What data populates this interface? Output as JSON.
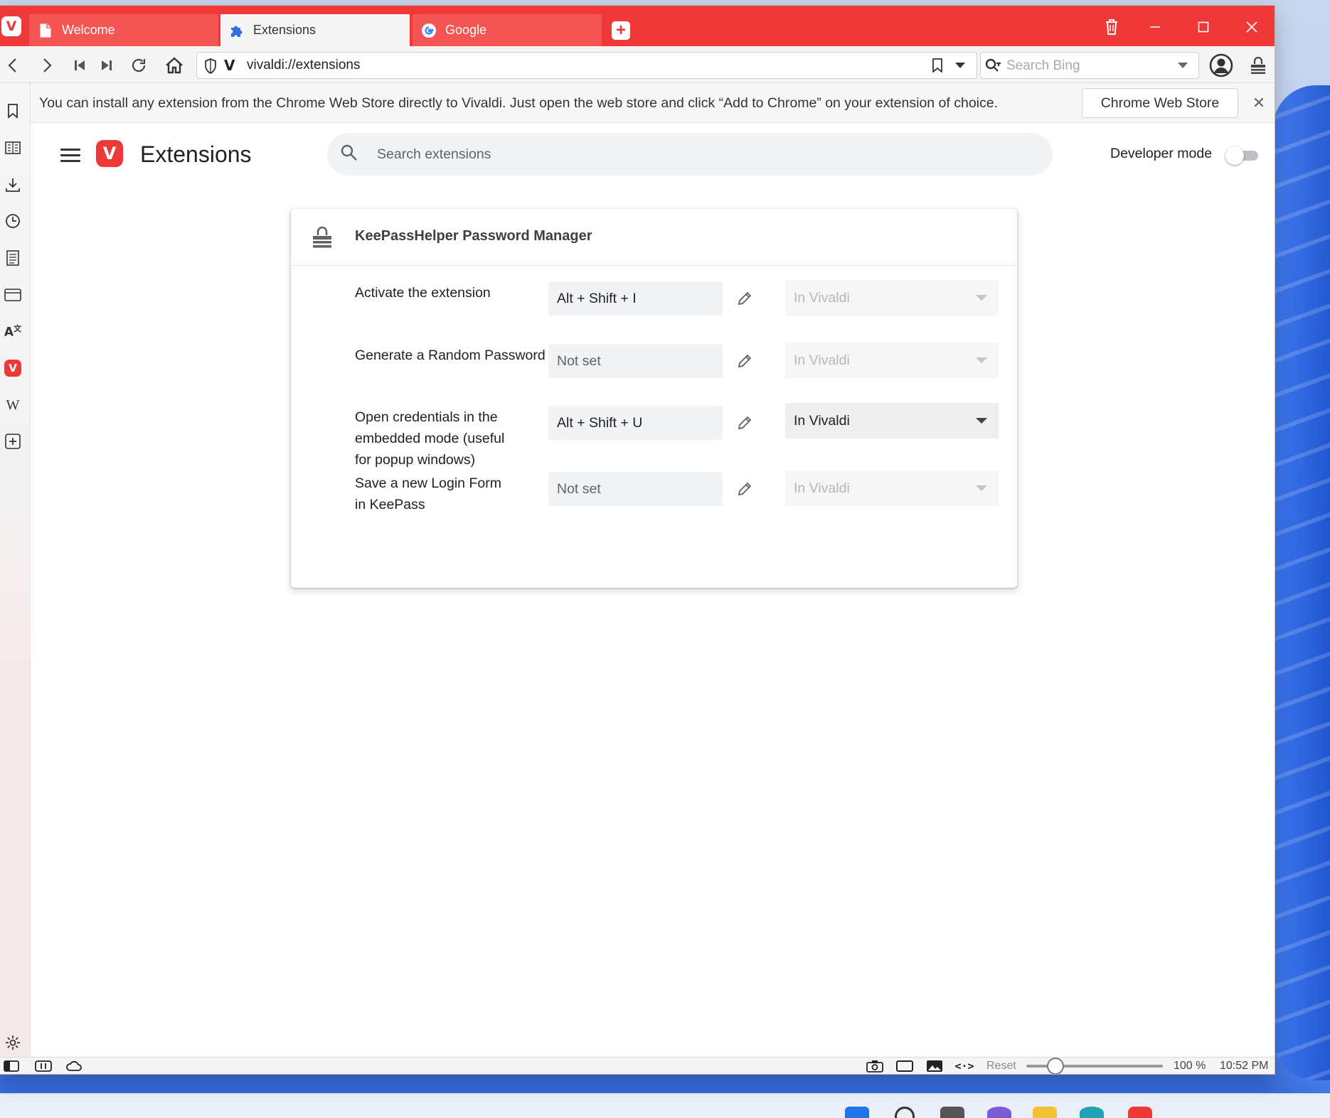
{
  "tabs": [
    {
      "label": "Welcome",
      "icon": "document-icon",
      "state": "inactive"
    },
    {
      "label": "Extensions",
      "icon": "puzzle-icon",
      "state": "active"
    },
    {
      "label": "Google",
      "icon": "google-icon",
      "state": "inactive"
    }
  ],
  "address_bar": {
    "url": "vivaldi://extensions",
    "search_placeholder": "Search Bing"
  },
  "infobar": {
    "message": "You can install any extension from the Chrome Web Store directly to Vivaldi. Just open the web store and click “Add to Chrome” on your extension of choice.",
    "button_label": "Chrome Web Store",
    "close_glyph": "✕"
  },
  "page": {
    "title": "Extensions",
    "search_placeholder": "Search extensions",
    "developer_mode_label": "Developer mode",
    "developer_mode_on": false
  },
  "extension": {
    "name": "KeePassHelper Password Manager",
    "shortcuts": [
      {
        "label": "Activate the extension",
        "shortcut": "Alt + Shift + I",
        "scope": "In Vivaldi",
        "scope_enabled": false
      },
      {
        "label": "Generate a Random Password",
        "shortcut": "Not set",
        "scope": "In Vivaldi",
        "scope_enabled": false
      },
      {
        "label": "Open credentials in the embedded mode (useful for popup windows)",
        "shortcut": "Alt + Shift + U",
        "scope": "In Vivaldi",
        "scope_enabled": true
      },
      {
        "label": "Save a new Login Form in KeePass",
        "shortcut": "Not set",
        "scope": "In Vivaldi",
        "scope_enabled": false
      }
    ]
  },
  "statusbar": {
    "reset_label": "Reset",
    "zoom_value": "100 %",
    "zoom_fraction": 0.17,
    "clock": "10:52 PM"
  },
  "colors": {
    "brand_red": "#ef3939",
    "active_tab": "#f5f5f5",
    "toolbar": "#f5f5f5"
  }
}
